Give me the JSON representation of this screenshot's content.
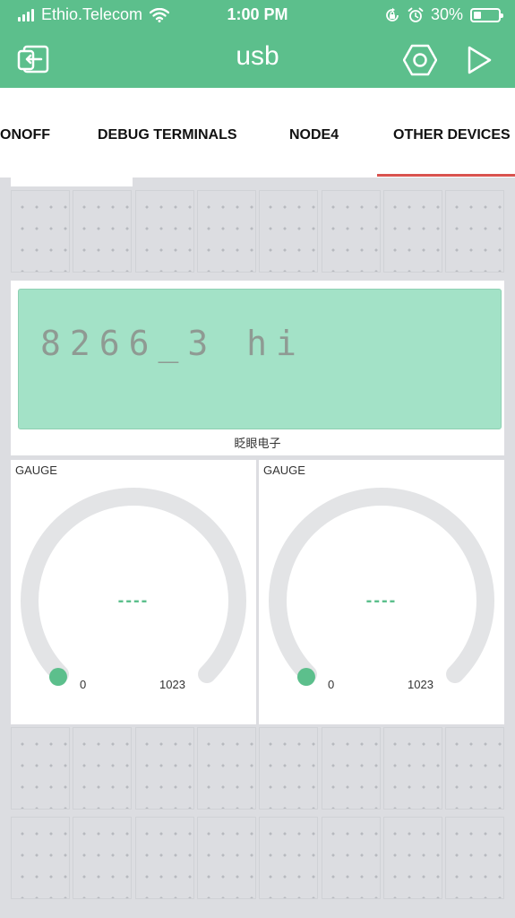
{
  "statusbar": {
    "carrier": "Ethio.Telecom",
    "time": "1:00 PM",
    "battery": "30%",
    "battery_level": 0.3
  },
  "header": {
    "title": "usb",
    "left_icon": "exit-icon",
    "right_icons": [
      "settings-hexagon-icon",
      "play-icon"
    ]
  },
  "tabs": {
    "items": [
      {
        "label": "ONOFF"
      },
      {
        "label": "DEBUG TERMINALS"
      },
      {
        "label": "NODE4"
      },
      {
        "label": "OTHER DEVICES"
      }
    ],
    "active": "OTHER DEVICES",
    "active_color": "#d9534f"
  },
  "lcd": {
    "line1": "8266_3 hi",
    "line2": "",
    "caption": "眨眼电子",
    "screen_color": "#a3e2c7"
  },
  "gauges": [
    {
      "label": "GAUGE",
      "value": "----",
      "min": "0",
      "max": "1023",
      "level": 0
    },
    {
      "label": "GAUGE",
      "value": "----",
      "min": "0",
      "max": "1023",
      "level": 0
    }
  ],
  "colors": {
    "accent": "#5cbf8c",
    "background": "#dcdde1"
  }
}
